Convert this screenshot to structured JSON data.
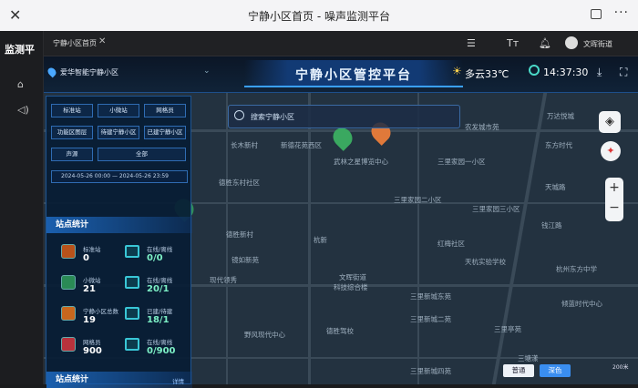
{
  "window": {
    "title": "宁静小区首页 - 噪声监测平台",
    "close_icon": "close-icon",
    "more_icon": "more-icon"
  },
  "leftnav": {
    "logo": "监测平",
    "items": [
      {
        "icon": "home-icon"
      },
      {
        "icon": "speaker-icon"
      }
    ]
  },
  "tabbar": {
    "tab_label": "宁静小区首页",
    "user_name": "文晖街道"
  },
  "header": {
    "location": "爱华智能宁静小区",
    "banner_title": "宁静小区管控平台",
    "weather": "多云33℃",
    "time": "14:37:30"
  },
  "search": {
    "placeholder": "搜索宁静小区"
  },
  "filters": {
    "row1": [
      "标准站",
      "小微站",
      "网格员"
    ],
    "row2": [
      "功能区图层",
      "待建宁静小区",
      "已建宁静小区"
    ],
    "row3_left": "声源",
    "row3_select": "全部",
    "date_start": "2024-05-26 00:00",
    "date_sep": "—",
    "date_end": "2024-05-26 23:59"
  },
  "stats": {
    "title": "站点统计",
    "rows": [
      {
        "left_label": "标准站",
        "left_value": "0",
        "right_label": "在线/离线",
        "right_value": "0/0"
      },
      {
        "left_label": "小微站",
        "left_value": "21",
        "right_label": "在线/离线",
        "right_value": "20/1"
      },
      {
        "left_label": "宁静小区总数",
        "left_value": "19",
        "right_label": "已建/待建",
        "right_value": "18/1"
      },
      {
        "left_label": "网格员",
        "left_value": "900",
        "right_label": "在线/离线",
        "right_value": "0/900"
      }
    ],
    "footer_title": "站点统计",
    "footer_link": "详情"
  },
  "map": {
    "labels": [
      "长木新村",
      "新德花苑西区",
      "武林之星博览中心",
      "三里家园一小区",
      "三里家园二小区",
      "三里家园三小区",
      "德胜东村社区",
      "德胜新村",
      "现代领秀",
      "野风现代中心",
      "文晖街道",
      "科技综合楼",
      "三里新城东苑",
      "三里新城二苑",
      "三里新城四苑",
      "德胜驾校",
      "三里亭苑",
      "杭新",
      "红梅社区",
      "天杭实验学校",
      "杭州东方中学",
      "倾蓝时代中心",
      "天城路",
      "钱江路",
      "东方时代",
      "万达悦城",
      "农发城市苑",
      "三塘漾",
      "镜如新苑"
    ],
    "mode_normal": "普通",
    "mode_deep": "深色",
    "scale": "200米"
  },
  "colors": {
    "accent": "#3aa0ff",
    "green_value": "#7df0c6",
    "panel_bg": "#081c34"
  }
}
